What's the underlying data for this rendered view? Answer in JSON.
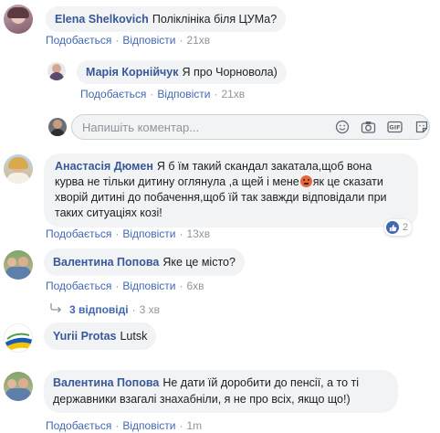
{
  "actions": {
    "like_label": "Подобається",
    "reply_label": "Відповісти"
  },
  "comments": [
    {
      "author": "Elena Shelkovich",
      "text": "Поліклініка біля ЦУМа?",
      "time": "21хв"
    },
    {
      "author": "Марія Корнійчук",
      "text": "Я про Чорновола)",
      "time": "21хв"
    },
    {
      "author": "Анастасія Дюмен",
      "text_lines": [
        "Я б їм такий скандал закатала,щоб вона",
        "курва не тільки дитину оглянула ,а щей і мене",
        "хворій дитині до побачення,щоб їй так завжди відповідали при",
        "таких ситуаціях козі!"
      ],
      "text_after_emoji": "як це сказати",
      "time": "13хв",
      "reactions_count": "2"
    },
    {
      "author": "Валентина Попова",
      "text": "Яке це місто?",
      "time": "6хв"
    },
    {
      "author": "Yurii Protas",
      "text": "Lutsk"
    },
    {
      "author": "Валентина Попова",
      "text_lines": [
        "Не дати їй доробити до пенсії, а то ті",
        "державники взагалі знахабніли, я не про всіх, якщо що!)"
      ],
      "time": "1m"
    }
  ],
  "reply_box": {
    "placeholder": "Напишіть коментар..."
  },
  "replies": {
    "label": "3 відповіді",
    "time": "3 хв"
  },
  "colors": {
    "link": "#4267b2",
    "author": "#385898",
    "bubble": "#f2f3f5",
    "meta": "#90949c"
  }
}
